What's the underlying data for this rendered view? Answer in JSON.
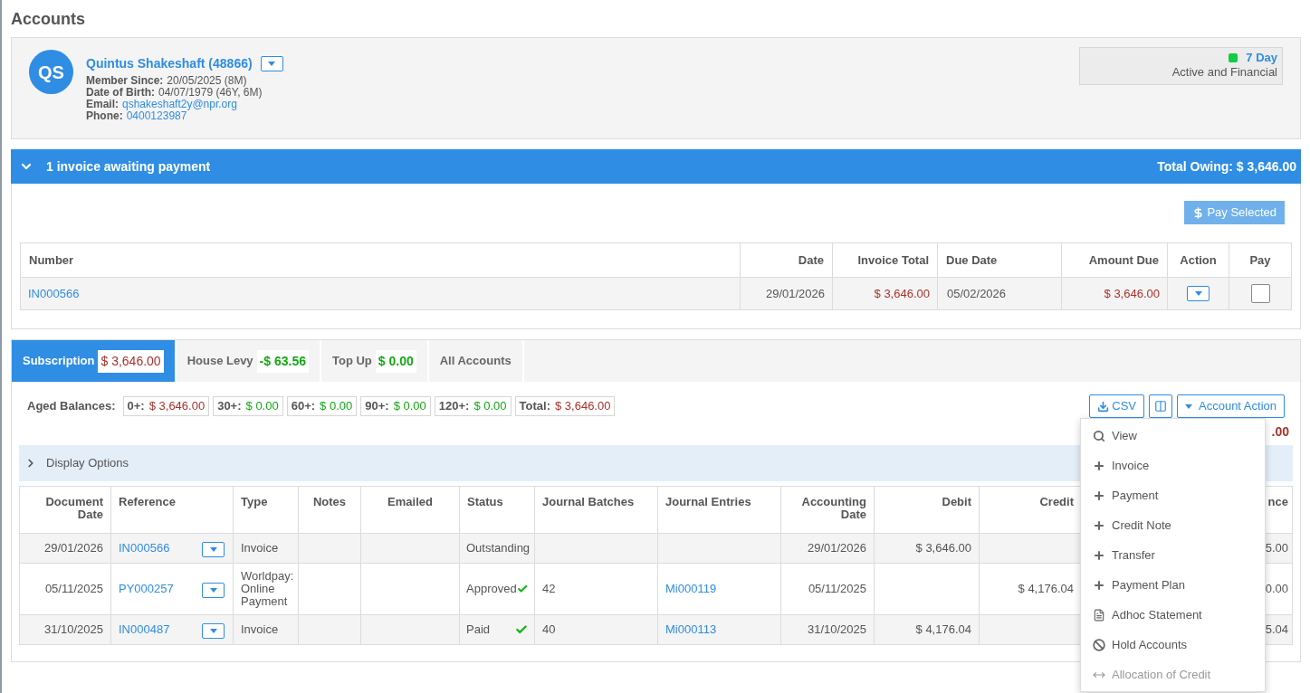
{
  "page_title": "Accounts",
  "member": {
    "initials": "QS",
    "name": "Quintus Shakeshaft (48866)",
    "details": [
      {
        "label": "Member Since:",
        "value": "20/05/2025 (8M)",
        "kind": "text"
      },
      {
        "label": "Date of Birth:",
        "value": "04/07/1979 (46Y, 6M)",
        "kind": "text"
      },
      {
        "label": "Email:",
        "value": "qshakeshaft2y@npr.org",
        "kind": "link"
      },
      {
        "label": "Phone:",
        "value": "0400123987",
        "kind": "link"
      }
    ],
    "status": {
      "color": "#11cc44",
      "term": "7 Day",
      "description": "Active and Financial"
    }
  },
  "invoices_panel": {
    "expanded": true,
    "title": "1 invoice awaiting payment",
    "total_owing": "Total Owing: $ 3,646.00",
    "pay_button": "Pay Selected",
    "columns": [
      "Number",
      "Date",
      "Invoice Total",
      "Due Date",
      "Amount Due",
      "Action",
      "Pay"
    ],
    "rows": [
      {
        "number": "IN000566",
        "date": "29/01/2026",
        "invoice_total": "$ 3,646.00",
        "due_date": "05/02/2026",
        "amount_due": "$ 3,646.00",
        "checked": false
      }
    ]
  },
  "tabs": [
    {
      "label": "Subscription",
      "amount": "$ 3,646.00",
      "owing": true,
      "selected": true
    },
    {
      "label": "House Levy",
      "amount": "-$ 63.56",
      "owing": false,
      "selected": false
    },
    {
      "label": "Top Up",
      "amount": "$ 0.00",
      "owing": false,
      "selected": false
    },
    {
      "label": "All Accounts",
      "selected": false
    }
  ],
  "aged_balances": {
    "label": "Aged Balances:",
    "items": [
      {
        "label": "0+:",
        "amount": "$ 3,646.00",
        "owing": true
      },
      {
        "label": "30+:",
        "amount": "$ 0.00",
        "owing": false
      },
      {
        "label": "60+:",
        "amount": "$ 0.00",
        "owing": false
      },
      {
        "label": "90+:",
        "amount": "$ 0.00",
        "owing": false
      },
      {
        "label": "120+:",
        "amount": "$ 0.00",
        "owing": false
      },
      {
        "label": "Total:",
        "amount": "$ 3,646.00",
        "owing": true
      }
    ]
  },
  "toolbar": {
    "csv_button": "CSV",
    "account_action_button": "Account Action",
    "balance_fragment": ".00"
  },
  "display_options": {
    "label": "Display Options",
    "expanded": false
  },
  "ledger": {
    "columns": [
      "Document Date",
      "Reference",
      "Type",
      "Notes",
      "Emailed",
      "Status",
      "Journal Batches",
      "Journal Entries",
      "Accounting Date",
      "Debit",
      "Credit",
      "nce"
    ],
    "rows": [
      {
        "document_date": "29/01/2026",
        "reference": "IN000566",
        "type": "Invoice",
        "status": "Outstanding",
        "verified": false,
        "journal_batch": "",
        "journal_entry": "",
        "accounting_date": "29/01/2026",
        "debit": "$ 3,646.00",
        "credit": "",
        "balance": "5.00"
      },
      {
        "document_date": "05/11/2025",
        "reference": "PY000257",
        "type": "Worldpay: Online Payment",
        "status": "Approved",
        "verified": true,
        "journal_batch": "42",
        "journal_entry": "Mi000119",
        "accounting_date": "05/11/2025",
        "debit": "",
        "credit": "$ 4,176.04",
        "balance": "0.00"
      },
      {
        "document_date": "31/10/2025",
        "reference": "IN000487",
        "type": "Invoice",
        "status": "Paid",
        "verified": true,
        "journal_batch": "40",
        "journal_entry": "Mi000113",
        "accounting_date": "31/10/2025",
        "debit": "$ 4,176.04",
        "credit": "",
        "balance": "5.04"
      }
    ]
  },
  "action_menu": {
    "open": true,
    "items": [
      {
        "label": "View",
        "kind": "view",
        "disabled": false
      },
      {
        "label": "Invoice",
        "kind": "add",
        "disabled": false
      },
      {
        "label": "Payment",
        "kind": "add",
        "disabled": false
      },
      {
        "label": "Credit Note",
        "kind": "add",
        "disabled": false
      },
      {
        "label": "Transfer",
        "kind": "add",
        "disabled": false
      },
      {
        "label": "Payment Plan",
        "kind": "add",
        "disabled": false
      },
      {
        "label": "Adhoc Statement",
        "kind": "statement",
        "disabled": false
      },
      {
        "label": "Hold Accounts",
        "kind": "hold",
        "disabled": false
      },
      {
        "label": "Allocation of Credit",
        "kind": "allocation",
        "disabled": true
      }
    ]
  }
}
